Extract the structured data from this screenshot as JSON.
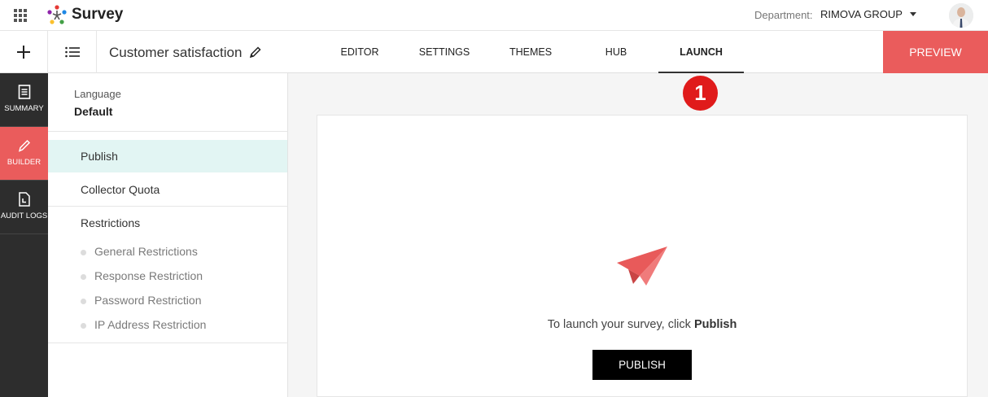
{
  "app": {
    "name": "Survey"
  },
  "header": {
    "department_label": "Department:",
    "department_value": "RIMOVA GROUP"
  },
  "toolbar": {
    "survey_title": "Customer satisfaction",
    "tabs": [
      {
        "label": "EDITOR",
        "active": false
      },
      {
        "label": "SETTINGS",
        "active": false
      },
      {
        "label": "THEMES",
        "active": false
      },
      {
        "label": "HUB",
        "active": false
      },
      {
        "label": "LAUNCH",
        "active": true
      }
    ],
    "preview_label": "PREVIEW"
  },
  "rail": {
    "items": [
      {
        "label": "SUMMARY",
        "icon": "document-icon",
        "active": false
      },
      {
        "label": "BUILDER",
        "icon": "pencil-icon",
        "active": true
      },
      {
        "label": "AUDIT LOGS",
        "icon": "log-file-icon",
        "active": false
      }
    ]
  },
  "panel": {
    "language_label": "Language",
    "language_value": "Default",
    "items": [
      {
        "label": "Publish",
        "active": true
      },
      {
        "label": "Collector Quota",
        "active": false
      },
      {
        "label": "Restrictions",
        "active": false
      }
    ],
    "sub_items": [
      {
        "label": "General Restrictions"
      },
      {
        "label": "Response Restriction"
      },
      {
        "label": "Password Restriction"
      },
      {
        "label": "IP Address Restriction"
      }
    ]
  },
  "main": {
    "launch_text": "To launch your survey, click",
    "launch_text_bold": "Publish",
    "publish_label": "PUBLISH"
  },
  "annotation": {
    "badge": "1"
  },
  "colors": {
    "accent": "#ea5c5c",
    "rail": "#2d2d2d",
    "active_item": "#e2f5f3",
    "badge": "#e01b1b"
  }
}
